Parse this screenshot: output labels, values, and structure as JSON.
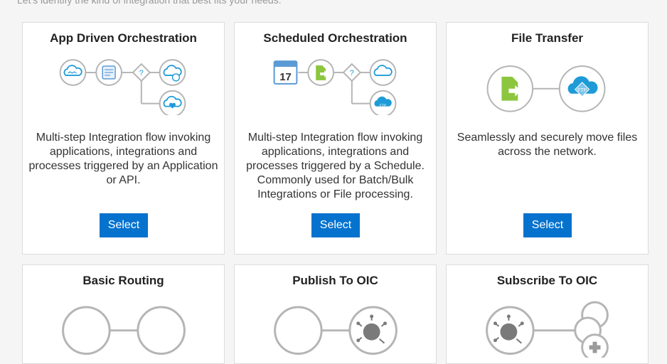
{
  "header": {
    "intro_text": "Let's identify the kind of integration that best fits your needs."
  },
  "patterns": [
    {
      "title": "App Driven Orchestration",
      "description": "Multi-step Integration flow invoking applications, integrations and processes triggered by an Application or API.",
      "select_label": "Select"
    },
    {
      "title": "Scheduled Orchestration",
      "description": "Multi-step Integration flow invoking applications, integrations and processes triggered by a Schedule. Commonly used for Batch/Bulk Integrations or File processing.",
      "select_label": "Select",
      "calendar_day": "17"
    },
    {
      "title": "File Transfer",
      "description": "Seamlessly and securely move files across the network.",
      "select_label": "Select",
      "ftp_label": "FTP"
    },
    {
      "title": "Basic Routing"
    },
    {
      "title": "Publish To OIC"
    },
    {
      "title": "Subscribe To OIC"
    }
  ],
  "icons": {
    "decision": "?",
    "ftp_small": "FTP"
  },
  "colors": {
    "accent": "#0572ce",
    "node_border": "#b5b5b5",
    "cloud_blue": "#1e9bd7",
    "file_green": "#8cc63f",
    "calendar_blue": "#5b9bd5"
  }
}
